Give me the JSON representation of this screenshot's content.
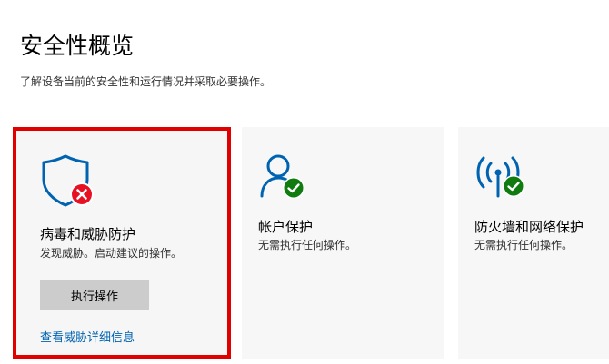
{
  "header": {
    "title": "安全性概览",
    "subtitle": "了解设备当前的安全性和运行情况并采取必要操作。"
  },
  "cards": {
    "virus": {
      "icon": "shield-icon",
      "status_icon": "error-x-icon",
      "title": "病毒和威胁防护",
      "description": "发现威胁。启动建议的操作。",
      "action_label": "执行操作",
      "link_label": "查看威胁详细信息"
    },
    "account": {
      "icon": "person-icon",
      "status_icon": "checkmark-icon",
      "title": "帐户保护",
      "description": "无需执行任何操作。"
    },
    "firewall": {
      "icon": "network-antenna-icon",
      "status_icon": "checkmark-icon",
      "title": "防火墙和网络保护",
      "description": "无需执行任何操作。"
    }
  },
  "colors": {
    "accent_blue": "#0063b1",
    "error_red": "#e81123",
    "ok_green": "#107c10",
    "highlight_border": "#e00000",
    "button_gray": "#cccccc"
  }
}
